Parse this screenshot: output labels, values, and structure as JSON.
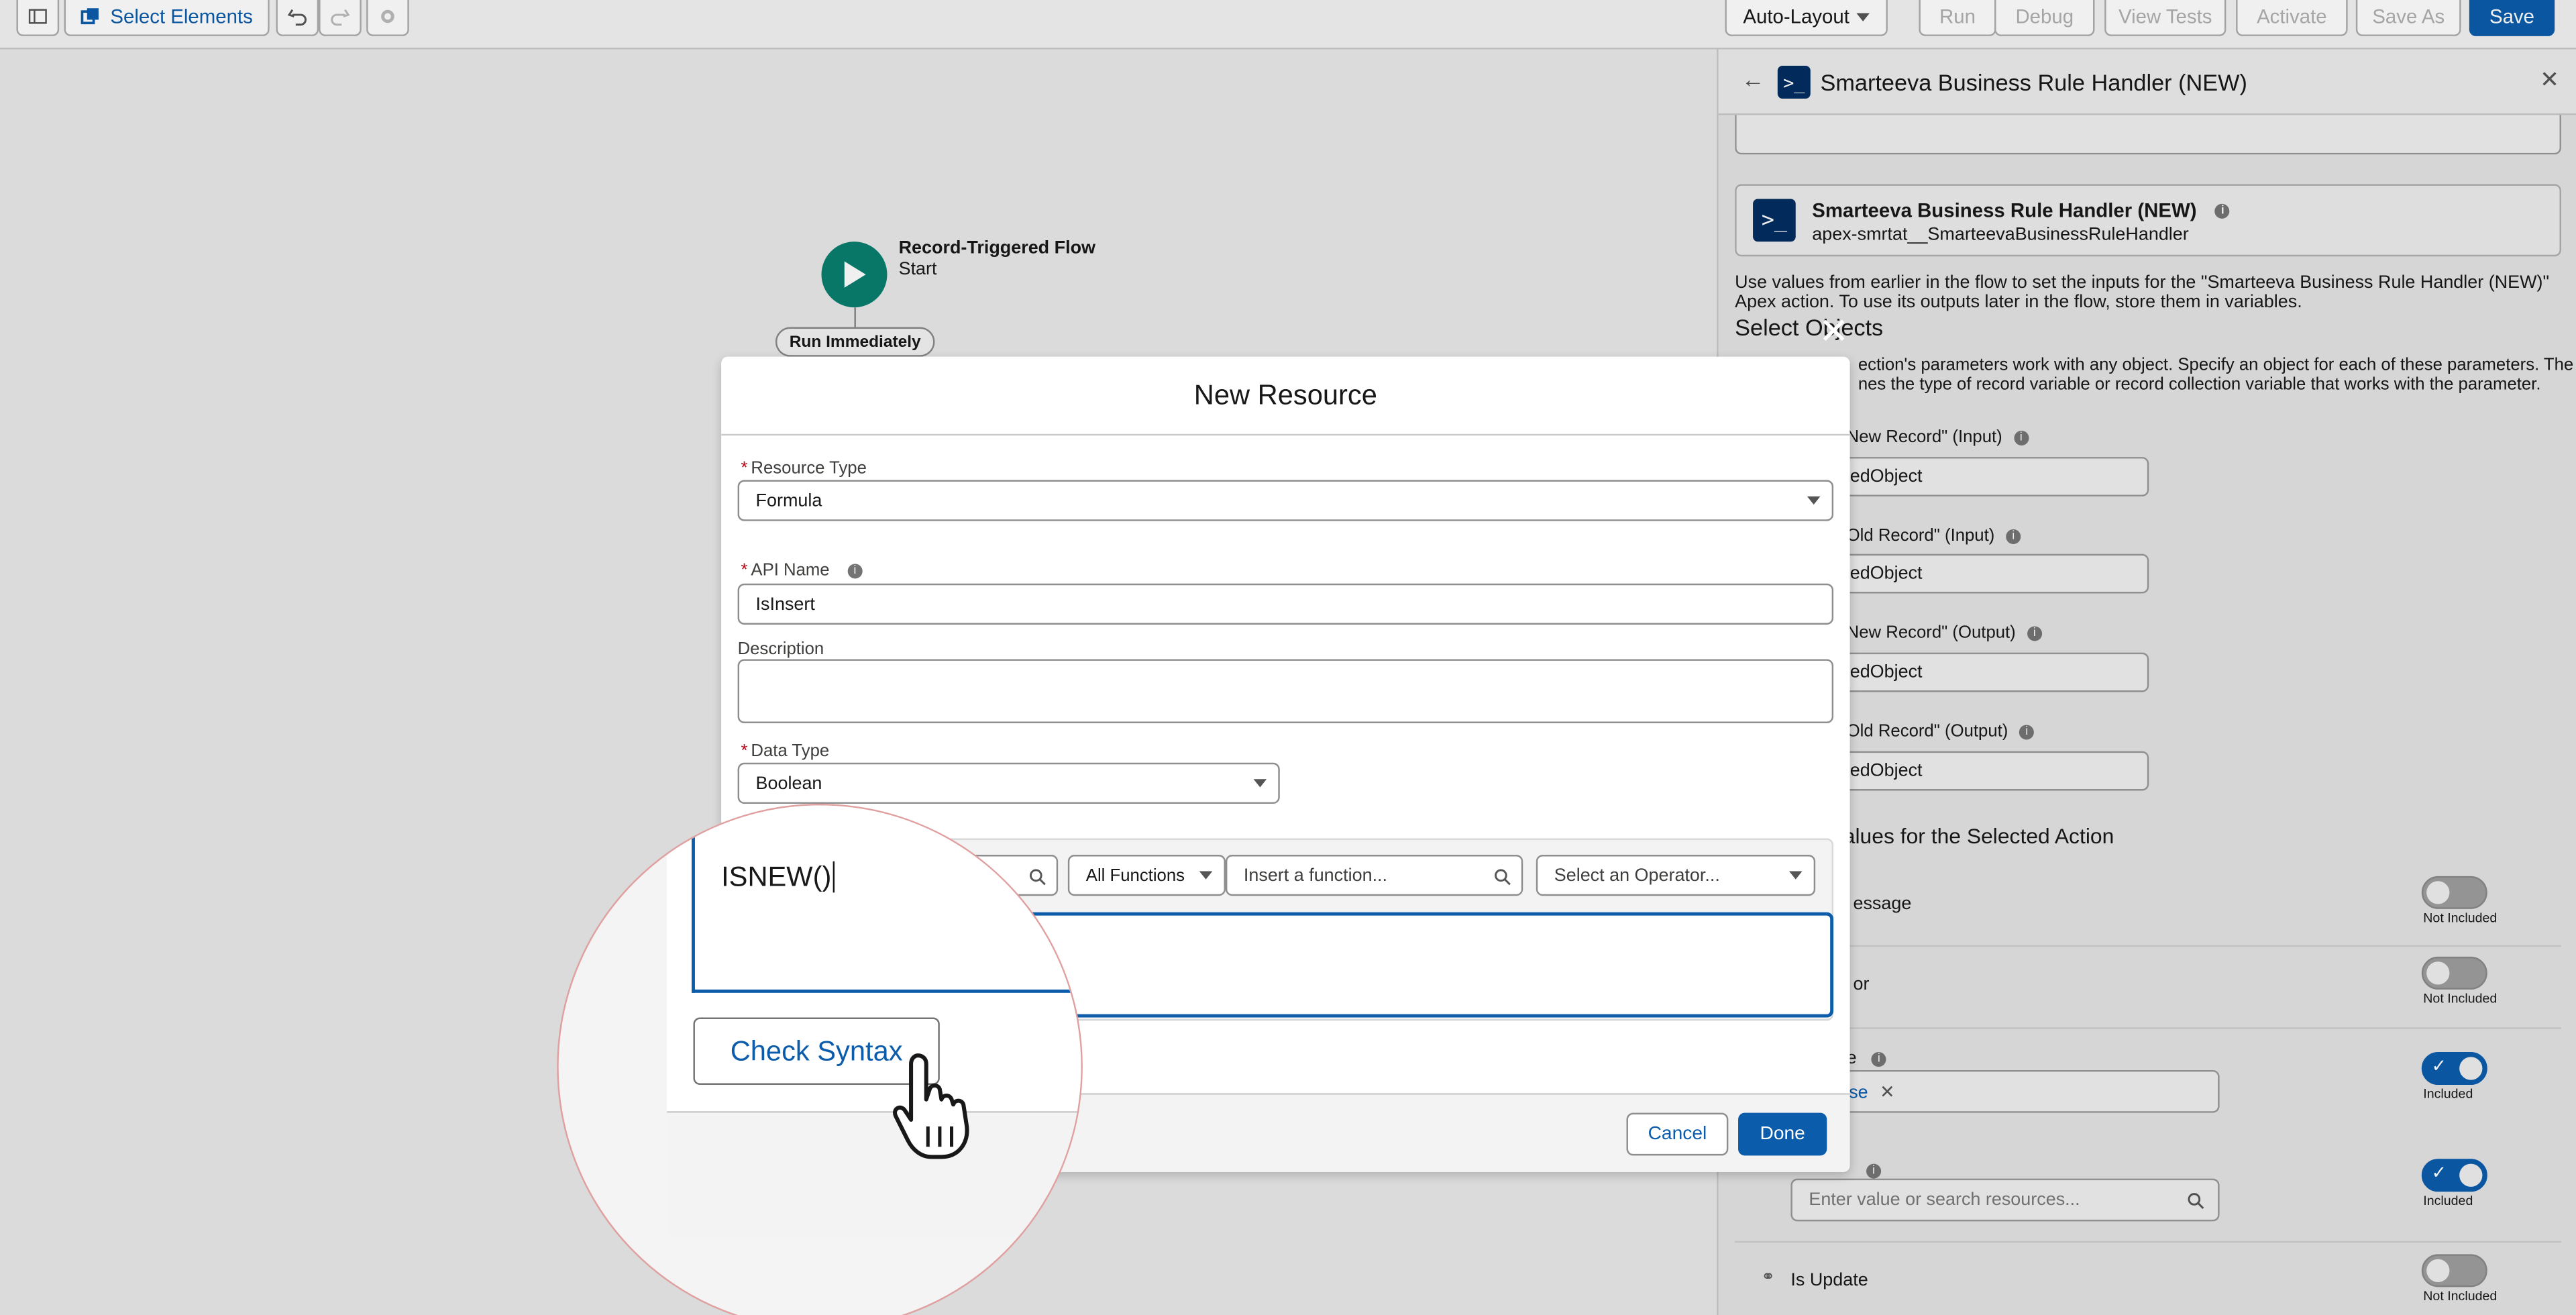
{
  "toolbar": {
    "select_elements": "Select Elements",
    "auto_layout": "Auto-Layout",
    "run": "Run",
    "debug": "Debug",
    "view_tests": "View Tests",
    "activate": "Activate",
    "save_as": "Save As",
    "save": "Save"
  },
  "canvas": {
    "start_title": "Record-Triggered Flow",
    "start_sub": "Start",
    "run_immediately": "Run Immediately"
  },
  "panel": {
    "title": "Smarteeva Business Rule Handler (NEW)",
    "action_name": "Smarteeva Business Rule Handler (NEW)",
    "action_api": "apex-smrtat__SmarteevaBusinessRuleHandler",
    "intro_line1": "Use values from earlier in the flow to set the inputs for the \"Smarteeva Business Rule Handler (NEW)\"",
    "intro_line2": "Apex action. To use its outputs later in the flow, store them in variables.",
    "select_objects": "Select Objects",
    "objects_desc1": "ection's parameters work with any object. Specify an object for each of these parameters. The",
    "objects_desc2": "nes the type of record variable or record collection variable that works with the parameter.",
    "params": [
      {
        "label": "New Record\" (Input)",
        "value": "tedObject"
      },
      {
        "label": "Old Record\" (Input)",
        "value": "tedObject"
      },
      {
        "label": "New Record\" (Output)",
        "value": "tedObject"
      },
      {
        "label": "Old Record\" (Output)",
        "value": "tedObject"
      }
    ],
    "values_heading": "alues for the Selected Action",
    "row_message": "essage",
    "row_or": "or",
    "row_e": "e",
    "pill_text": "lse",
    "search_placeholder": "Enter value or search resources...",
    "is_update": "Is Update",
    "not_included": "Not Included",
    "included": "Included"
  },
  "modal": {
    "title": "New Resource",
    "resource_type_label": "Resource Type",
    "resource_type_value": "Formula",
    "api_name_label": "API Name",
    "api_name_value": "IsInsert",
    "description_label": "Description",
    "data_type_label": "Data Type",
    "data_type_value": "Boolean",
    "all_functions": "All Functions",
    "insert_function_placeholder": "Insert a function...",
    "operator_placeholder": "Select an Operator...",
    "cancel": "Cancel",
    "done": "Done"
  },
  "magnifier": {
    "formula_text": "ISNEW()",
    "check_syntax": "Check Syntax"
  },
  "colors": {
    "brand_blue": "#0b5cab",
    "start_green": "#0a7f6e",
    "apex_navy": "#032d60"
  }
}
